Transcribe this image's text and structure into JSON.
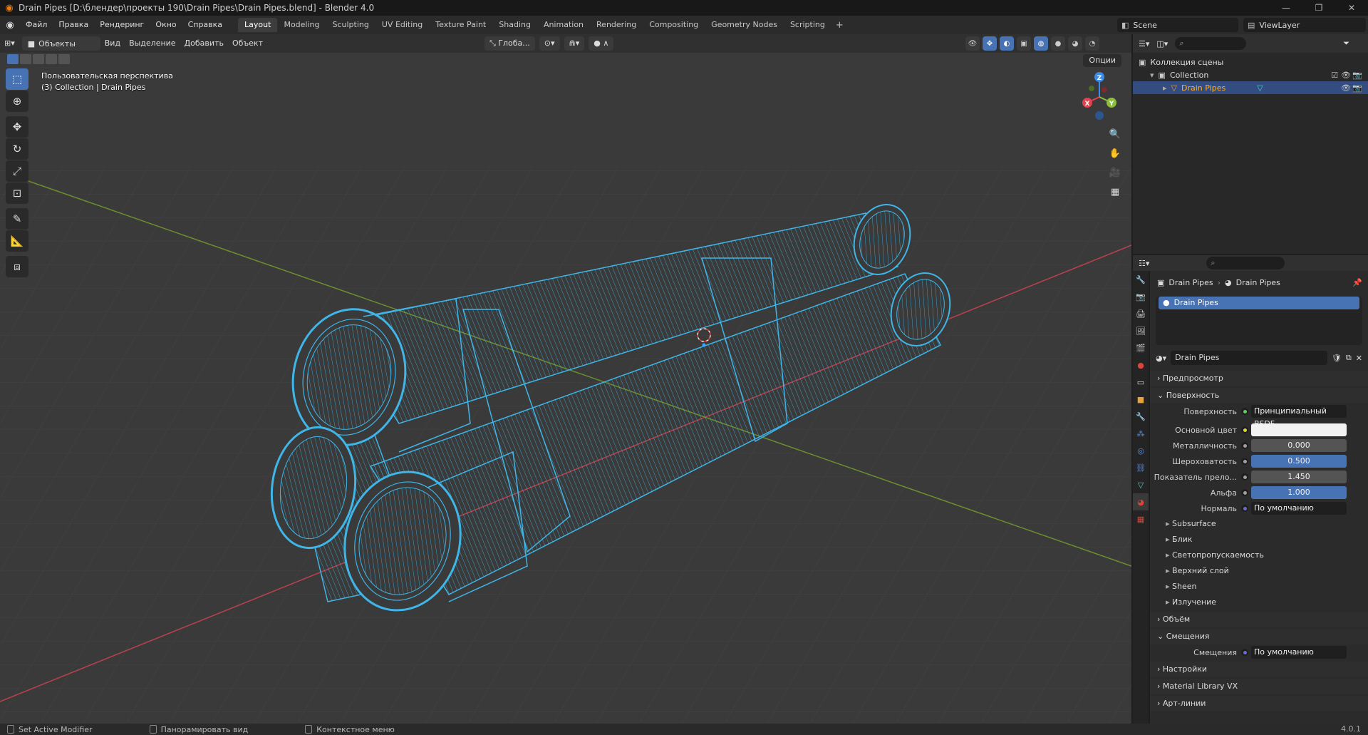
{
  "window": {
    "title": "Drain Pipes [D:\\блендер\\проекты 190\\Drain Pipes\\Drain Pipes.blend] - Blender 4.0"
  },
  "menu": [
    "Файл",
    "Правка",
    "Рендеринг",
    "Окно",
    "Справка"
  ],
  "workspaces": [
    {
      "label": "Layout",
      "active": true
    },
    {
      "label": "Modeling"
    },
    {
      "label": "Sculpting"
    },
    {
      "label": "UV Editing"
    },
    {
      "label": "Texture Paint"
    },
    {
      "label": "Shading"
    },
    {
      "label": "Animation"
    },
    {
      "label": "Rendering"
    },
    {
      "label": "Compositing"
    },
    {
      "label": "Geometry Nodes"
    },
    {
      "label": "Scripting"
    }
  ],
  "scene": {
    "name": "Scene",
    "view_layer": "ViewLayer"
  },
  "viewport_header": {
    "mode": "Объекты",
    "menus": [
      "Вид",
      "Выделение",
      "Добавить",
      "Объект"
    ],
    "orientation": "Глоба...",
    "options": "Опции"
  },
  "viewport": {
    "perspective": "Пользовательская перспектива",
    "collection_info": "(3) Collection | Drain Pipes",
    "gizmo": {
      "x": "X",
      "y": "Y",
      "z": "Z"
    }
  },
  "outliner": {
    "scene_collection": "Коллекция сцены",
    "collection": "Collection",
    "object": "Drain Pipes"
  },
  "properties": {
    "breadcrumb_object": "Drain Pipes",
    "breadcrumb_material": "Drain Pipes",
    "slot": "Drain Pipes",
    "material_name": "Drain Pipes",
    "panels": {
      "preview": "Предпросмотр",
      "surface": "Поверхность",
      "volume": "Объём",
      "displacement": "Смещения",
      "settings": "Настройки",
      "material_library": "Material Library VX",
      "lineart": "Арт-линии"
    },
    "surface_rows": [
      {
        "label": "Поверхность",
        "value": "Принципиальный BSDF",
        "kind": "dark",
        "dot": "#5bd35b"
      },
      {
        "label": "Основной цвет",
        "value": "",
        "kind": "white",
        "dot": "#e5d33b"
      },
      {
        "label": "Металличность",
        "value": "0.000",
        "kind": "grey",
        "dot": "#a0a0a0"
      },
      {
        "label": "Шероховатость",
        "value": "0.500",
        "kind": "blue",
        "dot": "#a0a0a0"
      },
      {
        "label": "Показатель прело...",
        "value": "1.450",
        "kind": "grey",
        "dot": "#a0a0a0"
      },
      {
        "label": "Альфа",
        "value": "1.000",
        "kind": "blue",
        "dot": "#a0a0a0"
      },
      {
        "label": "Нормаль",
        "value": "По умолчанию",
        "kind": "dark",
        "dot": "#6b6bd6"
      }
    ],
    "subpanels": [
      "Subsurface",
      "Блик",
      "Светопропускаемость",
      "Верхний слой",
      "Sheen",
      "Излучение"
    ],
    "displacement_row": {
      "label": "Смещения",
      "value": "По умолчанию"
    },
    "roughness_fraction": 0.5,
    "alpha_fraction": 1.0
  },
  "status": {
    "left": "Set Active Modifier",
    "middle": "Панорамировать вид",
    "right": "Контекстное меню",
    "version": "4.0.1"
  },
  "colors": {
    "accent": "#4772b3",
    "wire": "#3fb5e8",
    "x_axis": "#e0434f",
    "y_axis": "#8bc03a",
    "z_axis": "#3b8be8"
  },
  "icons": {
    "app": "blender-icon",
    "tools": [
      "select-box-icon",
      "cursor-icon",
      "move-icon",
      "rotate-icon",
      "scale-icon",
      "transform-icon",
      "annotate-icon",
      "measure-icon",
      "add-cube-icon"
    ],
    "nav": [
      "zoom-icon",
      "pan-hand-icon",
      "camera-icon",
      "grid-icon"
    ]
  }
}
